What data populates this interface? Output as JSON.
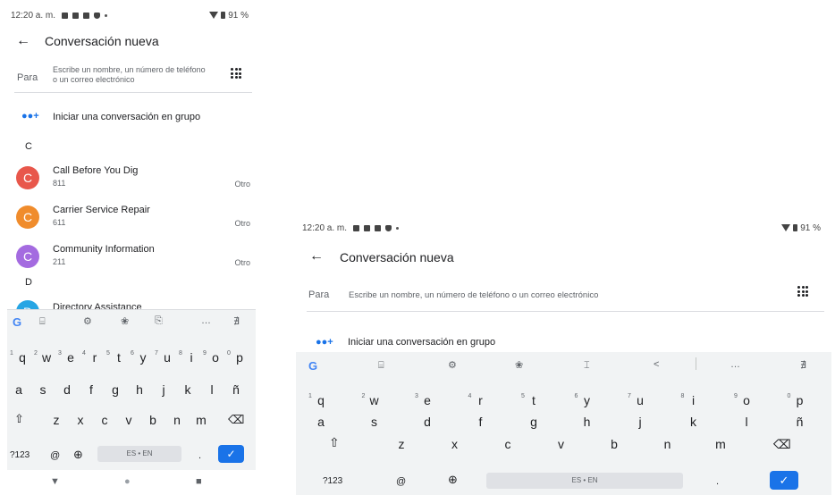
{
  "status": {
    "time": "12:20 a. m.",
    "battery": "91 %"
  },
  "header": {
    "title": "Conversación nueva",
    "back_icon": "arrow-left-icon"
  },
  "recipient": {
    "label": "Para",
    "placeholder_wrapped": [
      "Escribe un nombre, un número de teléfono",
      "o un correo electrónico"
    ],
    "placeholder": "Escribe un nombre, un número de teléfono o un correo electrónico"
  },
  "group": {
    "label": "Iniciar una conversación en grupo",
    "icon": "group-add-icon"
  },
  "sections": [
    {
      "letter": "C",
      "contacts": [
        {
          "initial": "C",
          "name": "Call Before You Dig",
          "number": "811",
          "type": "Otro",
          "color": "#e8574b"
        },
        {
          "initial": "C",
          "name": "Carrier Service Repair",
          "number": "611",
          "type": "Otro",
          "color": "#f08c2c"
        },
        {
          "initial": "C",
          "name": "Community Information",
          "number": "211",
          "type": "Otro",
          "color": "#a46be0"
        }
      ]
    },
    {
      "letter": "D",
      "contacts": [
        {
          "initial": "D",
          "name": "Directory Assistance",
          "color": "#26a5e4"
        }
      ]
    }
  ],
  "keyboard": {
    "toolbar_small": [
      "G",
      "⌸",
      "⚙",
      "❀",
      "⎘",
      "…",
      "∄"
    ],
    "toolbar_large": [
      "G",
      "⌸",
      "⚙",
      "❀",
      "⌶",
      "<",
      "…",
      "∄"
    ],
    "row1": [
      "q",
      "w",
      "e",
      "r",
      "t",
      "y",
      "u",
      "i",
      "o",
      "p"
    ],
    "row1_nums": [
      "1",
      "2",
      "3",
      "4",
      "5",
      "6",
      "7",
      "8",
      "9",
      "0"
    ],
    "row2": [
      "a",
      "s",
      "d",
      "f",
      "g",
      "h",
      "j",
      "k",
      "l",
      "ñ"
    ],
    "row3": [
      "z",
      "x",
      "c",
      "v",
      "b",
      "n",
      "m"
    ],
    "shift": "⇧",
    "backspace": "⌫",
    "symbols": "?123",
    "at": "@",
    "globe": "⊕",
    "space_label": "ES • EN",
    "period": ".",
    "enter": "✓"
  },
  "nav": [
    "▼",
    "●",
    "■"
  ],
  "colors": {
    "accent": "#1a73e8",
    "keyboard_bg": "#f1f3f4"
  }
}
